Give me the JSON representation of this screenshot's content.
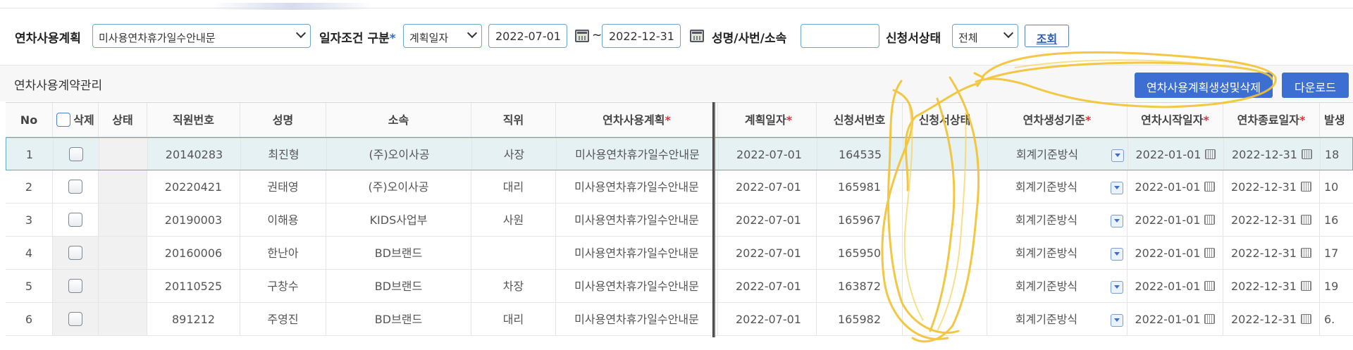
{
  "filter": {
    "plan_label": "연차사용계획",
    "plan_value": "미사용연차휴가일수안내문",
    "date_cond_label": "일자조건 구분",
    "date_cond_required": "*",
    "date_cond_value": "계획일자",
    "date_from": "2022-07-01",
    "tilde": "~",
    "date_to": "2022-12-31",
    "name_label": "성명/사번/소속",
    "name_value": "",
    "status_label": "신청서상태",
    "status_value": "전체",
    "search_button": "조회"
  },
  "section": {
    "title": "연차사용계약관리",
    "create_delete_button": "연차사용계획생성및삭제",
    "download_button": "다운로드"
  },
  "grid": {
    "headers": {
      "no": "No",
      "delete": "삭제",
      "status": "상태",
      "emp_no": "직원번호",
      "name": "성명",
      "dept": "소속",
      "position": "직위",
      "plan": "연차사용계획",
      "plan_date": "계획일자",
      "app_no": "신청서번호",
      "app_status": "신청서상태",
      "basis": "연차생성기준",
      "start": "연차시작일자",
      "end": "연차종료일자",
      "issue": "발생"
    },
    "required_mark": "*",
    "rows": [
      {
        "no": "1",
        "emp_no": "20140283",
        "name": "최진형",
        "dept": "(주)오이사공",
        "position": "사장",
        "plan": "미사용연차휴가일수안내문",
        "plan_date": "2022-07-01",
        "app_no": "164535",
        "app_status": "",
        "basis": "회계기준방식",
        "start": "2022-01-01",
        "end": "2022-12-31",
        "issue": "18"
      },
      {
        "no": "2",
        "emp_no": "20220421",
        "name": "권태영",
        "dept": "(주)오이사공",
        "position": "대리",
        "plan": "미사용연차휴가일수안내문",
        "plan_date": "2022-07-01",
        "app_no": "165981",
        "app_status": "",
        "basis": "회계기준방식",
        "start": "2022-01-01",
        "end": "2022-12-31",
        "issue": "10"
      },
      {
        "no": "3",
        "emp_no": "20190003",
        "name": "이해용",
        "dept": "KIDS사업부",
        "position": "사원",
        "plan": "미사용연차휴가일수안내문",
        "plan_date": "2022-07-01",
        "app_no": "165967",
        "app_status": "",
        "basis": "회계기준방식",
        "start": "2022-01-01",
        "end": "2022-12-31",
        "issue": "16"
      },
      {
        "no": "4",
        "emp_no": "20160006",
        "name": "한난아",
        "dept": "BD브랜드",
        "position": "",
        "plan": "미사용연차휴가일수안내문",
        "plan_date": "2022-07-01",
        "app_no": "165950",
        "app_status": "",
        "basis": "회계기준방식",
        "start": "2022-01-01",
        "end": "2022-12-31",
        "issue": "17"
      },
      {
        "no": "5",
        "emp_no": "20110525",
        "name": "구창수",
        "dept": "BD브랜드",
        "position": "차장",
        "plan": "미사용연차휴가일수안내문",
        "plan_date": "2022-07-01",
        "app_no": "163872",
        "app_status": "",
        "basis": "회계기준방식",
        "start": "2022-01-01",
        "end": "2022-12-31",
        "issue": "19"
      },
      {
        "no": "6",
        "emp_no": "891212",
        "name": "주영진",
        "dept": "BD브랜드",
        "position": "대리",
        "plan": "미사용연차휴가일수안내문",
        "plan_date": "2022-07-01",
        "app_no": "165982",
        "app_status": "",
        "basis": "회계기준방식",
        "start": "2022-01-01",
        "end": "2022-12-31",
        "issue": "6."
      }
    ]
  },
  "colors": {
    "accent": "#3d6fd3",
    "required": "#e0313b",
    "highlight_annotation": "#f2c230",
    "selected_row": "#e6f1f3"
  }
}
